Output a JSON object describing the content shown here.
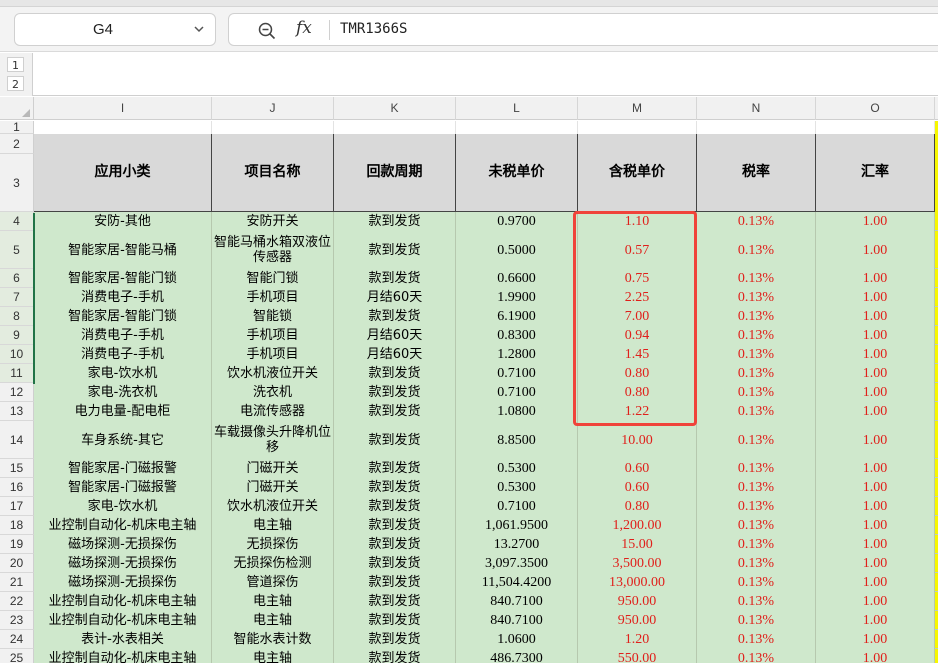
{
  "formula_bar": {
    "cell_ref": "G4",
    "fx_label": "fx",
    "formula_value": "TMR1366S"
  },
  "outline_levels": [
    "1",
    "2"
  ],
  "columns": [
    {
      "letter": "I"
    },
    {
      "letter": "J"
    },
    {
      "letter": "K"
    },
    {
      "letter": "L"
    },
    {
      "letter": "M"
    },
    {
      "letter": "N"
    },
    {
      "letter": "O"
    }
  ],
  "headers": [
    "应用小类",
    "项目名称",
    "回款周期",
    "未税单价",
    "含税单价",
    "税率",
    "汇率"
  ],
  "top_row_numbers": [
    "1",
    "2",
    "3"
  ],
  "rows": [
    {
      "n": "4",
      "cells": [
        "安防-其他",
        "安防开关",
        "款到发货",
        "0.9700",
        "1.10",
        "0.13%",
        "1.00"
      ]
    },
    {
      "n": "5",
      "cells": [
        "智能家居-智能马桶",
        "智能马桶水箱双液位传感器",
        "款到发货",
        "0.5000",
        "0.57",
        "0.13%",
        "1.00"
      ]
    },
    {
      "n": "6",
      "cells": [
        "智能家居-智能门锁",
        "智能门锁",
        "款到发货",
        "0.6600",
        "0.75",
        "0.13%",
        "1.00"
      ]
    },
    {
      "n": "7",
      "cells": [
        "消费电子-手机",
        "手机项目",
        "月结60天",
        "1.9900",
        "2.25",
        "0.13%",
        "1.00"
      ]
    },
    {
      "n": "8",
      "cells": [
        "智能家居-智能门锁",
        "智能锁",
        "款到发货",
        "6.1900",
        "7.00",
        "0.13%",
        "1.00"
      ]
    },
    {
      "n": "9",
      "cells": [
        "消费电子-手机",
        "手机项目",
        "月结60天",
        "0.8300",
        "0.94",
        "0.13%",
        "1.00"
      ]
    },
    {
      "n": "10",
      "cells": [
        "消费电子-手机",
        "手机项目",
        "月结60天",
        "1.2800",
        "1.45",
        "0.13%",
        "1.00"
      ]
    },
    {
      "n": "11",
      "cells": [
        "家电-饮水机",
        "饮水机液位开关",
        "款到发货",
        "0.7100",
        "0.80",
        "0.13%",
        "1.00"
      ]
    },
    {
      "n": "12",
      "cells": [
        "家电-洗衣机",
        "洗衣机",
        "款到发货",
        "0.7100",
        "0.80",
        "0.13%",
        "1.00"
      ]
    },
    {
      "n": "13",
      "cells": [
        "电力电量-配电柜",
        "电流传感器",
        "款到发货",
        "1.0800",
        "1.22",
        "0.13%",
        "1.00"
      ]
    },
    {
      "n": "14",
      "cells": [
        "车身系统-其它",
        "车载摄像头升降机位移",
        "款到发货",
        "8.8500",
        "10.00",
        "0.13%",
        "1.00"
      ]
    },
    {
      "n": "15",
      "cells": [
        "智能家居-门磁报警",
        "门磁开关",
        "款到发货",
        "0.5300",
        "0.60",
        "0.13%",
        "1.00"
      ]
    },
    {
      "n": "16",
      "cells": [
        "智能家居-门磁报警",
        "门磁开关",
        "款到发货",
        "0.5300",
        "0.60",
        "0.13%",
        "1.00"
      ]
    },
    {
      "n": "17",
      "cells": [
        "家电-饮水机",
        "饮水机液位开关",
        "款到发货",
        "0.7100",
        "0.80",
        "0.13%",
        "1.00"
      ]
    },
    {
      "n": "18",
      "cells": [
        "业控制自动化-机床电主轴",
        "电主轴",
        "款到发货",
        "1,061.9500",
        "1,200.00",
        "0.13%",
        "1.00"
      ]
    },
    {
      "n": "19",
      "cells": [
        "磁场探测-无损探伤",
        "无损探伤",
        "款到发货",
        "13.2700",
        "15.00",
        "0.13%",
        "1.00"
      ]
    },
    {
      "n": "20",
      "cells": [
        "磁场探测-无损探伤",
        "无损探伤检测",
        "款到发货",
        "3,097.3500",
        "3,500.00",
        "0.13%",
        "1.00"
      ]
    },
    {
      "n": "21",
      "cells": [
        "磁场探测-无损探伤",
        "管道探伤",
        "款到发货",
        "11,504.4200",
        "13,000.00",
        "0.13%",
        "1.00"
      ]
    },
    {
      "n": "22",
      "cells": [
        "业控制自动化-机床电主轴",
        "电主轴",
        "款到发货",
        "840.7100",
        "950.00",
        "0.13%",
        "1.00"
      ]
    },
    {
      "n": "23",
      "cells": [
        "业控制自动化-机床电主轴",
        "电主轴",
        "款到发货",
        "840.7100",
        "950.00",
        "0.13%",
        "1.00"
      ]
    },
    {
      "n": "24",
      "cells": [
        "表计-水表相关",
        "智能水表计数",
        "款到发货",
        "1.0600",
        "1.20",
        "0.13%",
        "1.00"
      ]
    },
    {
      "n": "25",
      "cells": [
        "业控制自动化-机床电主轴",
        "电主轴",
        "款到发货",
        "486.7300",
        "550.00",
        "0.13%",
        "1.00"
      ]
    }
  ],
  "colors": {
    "data_fill": "#cfe8cc",
    "header_fill": "#d9d9d9",
    "value_red": "#e0201b",
    "highlight_box": "#f0433a"
  }
}
